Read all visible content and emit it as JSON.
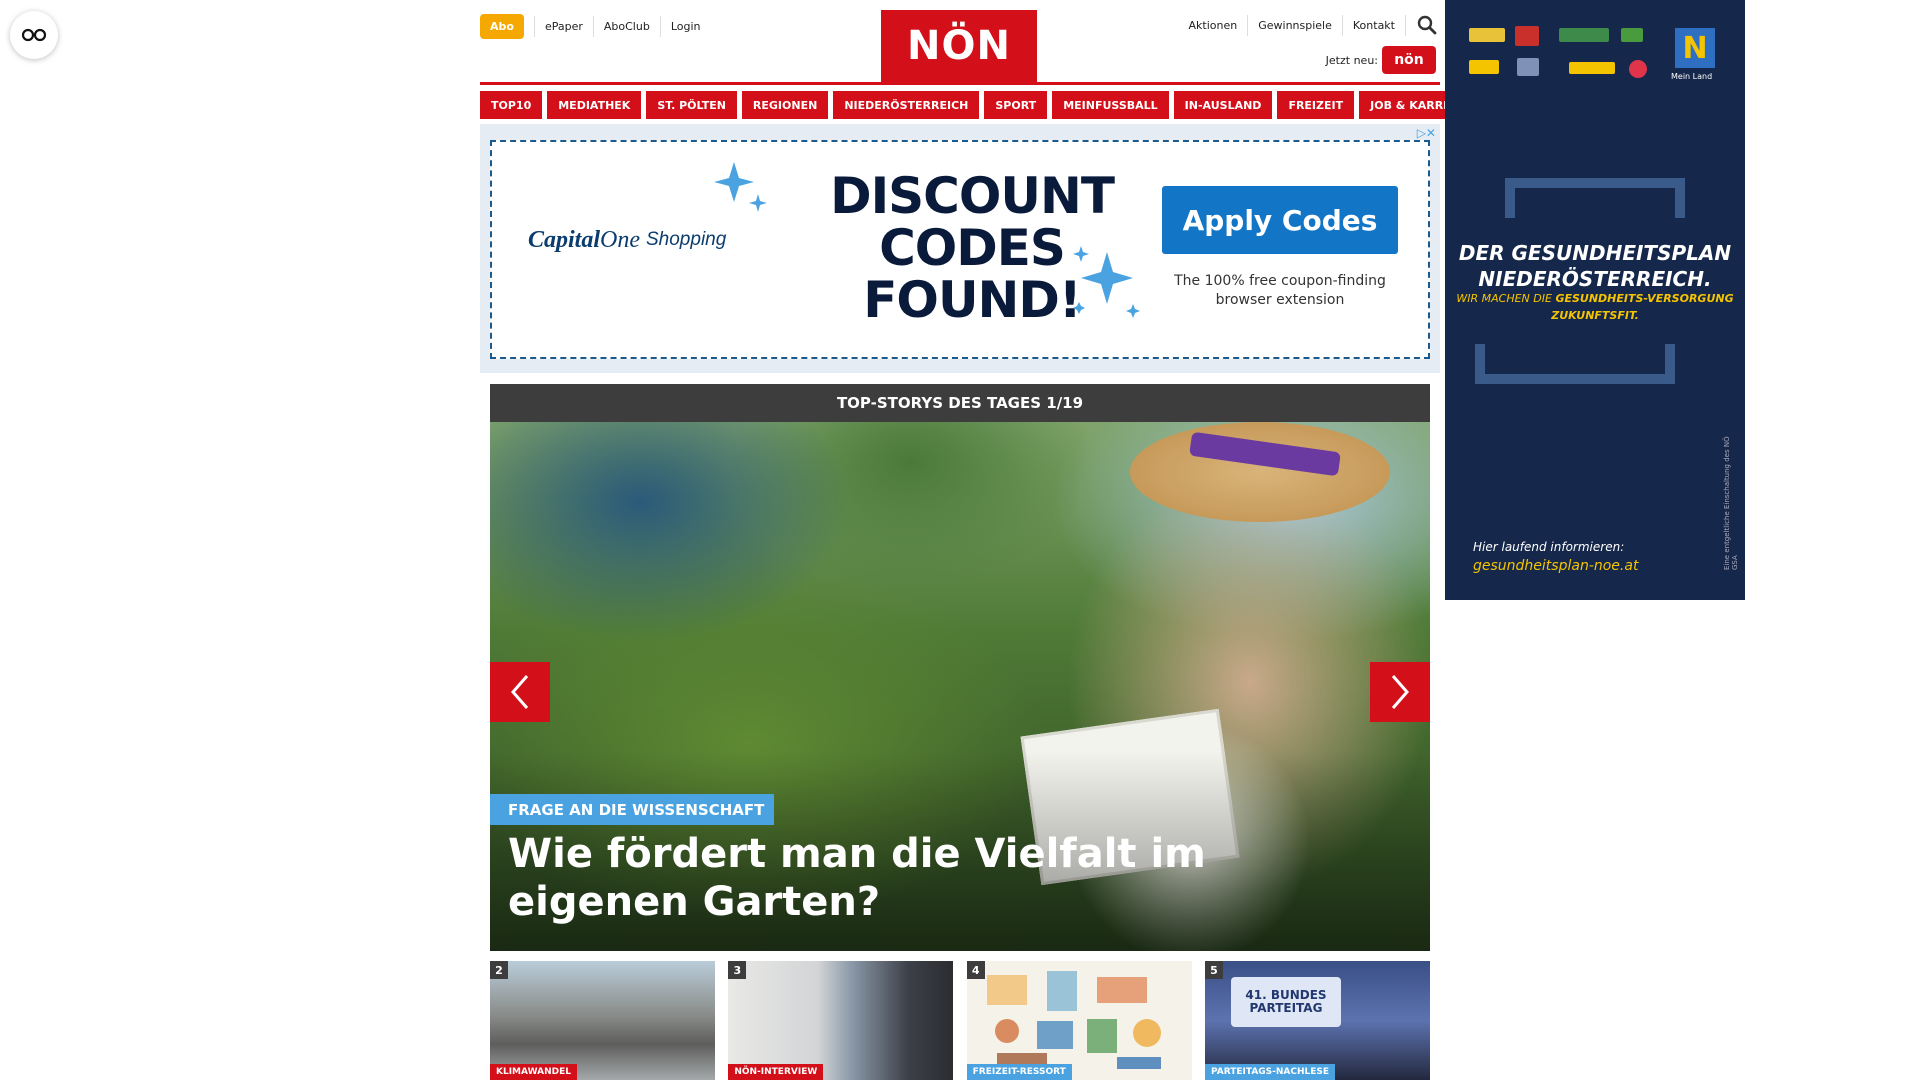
{
  "header": {
    "abo": "Abo",
    "left_links": [
      "ePaper",
      "AboClub",
      "Login"
    ],
    "logo": "NÖN",
    "right_links": [
      "Aktionen",
      "Gewinnspiele",
      "Kontakt"
    ],
    "jetzt_neu": "Jetzt neu:",
    "jetzt_badge": "nön"
  },
  "section_nav": [
    "TOP10",
    "MEDIATHEK",
    "ST. PÖLTEN",
    "REGIONEN",
    "NIEDERÖSTERREICH",
    "SPORT",
    "MEINFUSSBALL",
    "IN-AUSLAND",
    "FREIZEIT",
    "JOB & KARRIERE"
  ],
  "ad": {
    "brand": "Capital",
    "brand_one": "One",
    "brand_sub": "Shopping",
    "headline": "DISCOUNT CODES FOUND!",
    "button": "Apply Codes",
    "subtext": "The 100% free coupon-finding browser extension"
  },
  "side_ad": {
    "title": "DER GESUNDHEITSPLAN NIEDERÖSTERREICH.",
    "subtitle_plain": "WIR MACHEN DIE ",
    "subtitle_highlight": "GESUNDHEITS-VERSORGUNG ZUKUNFTSFIT.",
    "info_label": "Hier laufend informieren:",
    "info_url": "gesundheitsplan-noe.at",
    "brand_n": "N",
    "brand_label": "Mein Land",
    "vertical_note": "Eine entgeltliche Einschaltung des NÖ GSA"
  },
  "stories": {
    "header": "TOP-STORYS DES TAGES 1/19",
    "hero_category": "FRAGE AN DIE WISSENSCHAFT",
    "hero_title": "Wie fördert man die Vielfalt im eigenen Garten?",
    "thumbs": [
      {
        "num": "2",
        "category": "KLIMAWANDEL",
        "cat_color": "#d3101a"
      },
      {
        "num": "3",
        "category": "NÖN-INTERVIEW",
        "cat_color": "#d3101a"
      },
      {
        "num": "4",
        "category": "FREIZEIT-RESSORT",
        "cat_color": "#4aa3e0"
      },
      {
        "num": "5",
        "category": "PARTEITAGS-NACHLESE",
        "cat_color": "#4aa3e0"
      }
    ],
    "thumb4_badge": "41. BUNDES PARTEITAG"
  },
  "colors": {
    "brand_red": "#d3101a",
    "abo_yellow": "#f5a800",
    "accent_blue": "#4aa3e0",
    "side_navy": "#15274a"
  }
}
